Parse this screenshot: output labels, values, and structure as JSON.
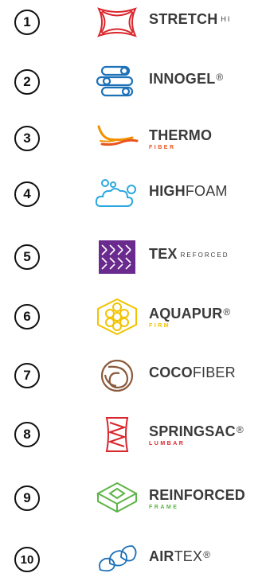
{
  "items": [
    {
      "num": "1",
      "bold": "STRETCH",
      "thin": "",
      "suffix": "HI",
      "sub": "",
      "icon": "stretch-fabric-icon",
      "color": "#d9252b"
    },
    {
      "num": "2",
      "bold": "INNOGEL",
      "thin": "",
      "suffix": "®",
      "sub": "",
      "icon": "gel-layers-icon",
      "color": "#1d71b8"
    },
    {
      "num": "3",
      "bold": "THERMO",
      "thin": "",
      "suffix": "",
      "sub": "FIBER",
      "icon": "thermo-waves-icon",
      "color": "#e8541e"
    },
    {
      "num": "4",
      "bold": "HIGH",
      "thin": "FOAM",
      "suffix": "",
      "sub": "",
      "icon": "cloud-bubbles-icon",
      "color": "#2aa8e0"
    },
    {
      "num": "5",
      "bold": "TEX",
      "thin": "",
      "suffix": "REFORCED",
      "sub": "",
      "icon": "woven-fabric-icon",
      "color": "#6a2a8e"
    },
    {
      "num": "6",
      "bold": "AQUAPUR",
      "thin": "",
      "suffix": "®",
      "sub": "FIRM",
      "icon": "honeycomb-icon",
      "color": "#f2c300"
    },
    {
      "num": "7",
      "bold": "COCO",
      "thin": "FIBER",
      "suffix": "",
      "sub": "",
      "icon": "coconut-fiber-icon",
      "color": "#8a5a3b"
    },
    {
      "num": "8",
      "bold": "SPRINGSAC",
      "thin": "",
      "suffix": "®",
      "sub": "LUMBAR",
      "icon": "pocket-spring-icon",
      "color": "#d9252b"
    },
    {
      "num": "9",
      "bold": "REINFORCED",
      "thin": "",
      "suffix": "",
      "sub": "FRAME",
      "icon": "frame-box-icon",
      "color": "#5db446"
    },
    {
      "num": "10",
      "bold": "AIR",
      "thin": "TEX",
      "suffix": "®",
      "sub": "",
      "icon": "air-mesh-icon",
      "color": "#1d71b8"
    }
  ]
}
